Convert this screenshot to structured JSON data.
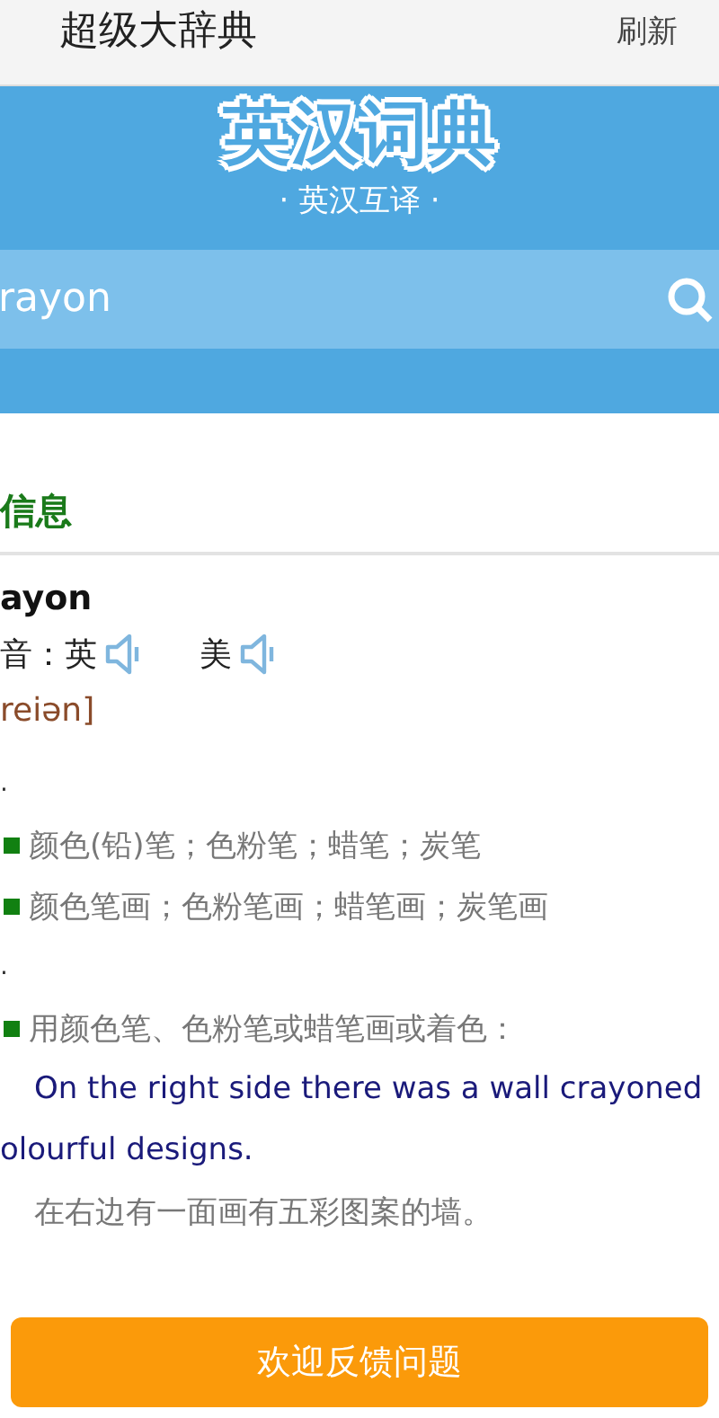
{
  "header": {
    "title": "超级大辞典",
    "action": "刷新"
  },
  "banner": {
    "logo": "英汉词典",
    "subtitle": "· 英汉互译 ·",
    "search": {
      "value": "rayon"
    }
  },
  "section": {
    "title": "信息"
  },
  "entry": {
    "word": "ayon",
    "pronunciation": {
      "label": "音：",
      "uk": "英",
      "us": "美"
    },
    "phonetic": "reiən]"
  },
  "senses": [
    {
      "kind": "pos",
      "text": "."
    },
    {
      "kind": "definition",
      "text": "颜色(铅)笔；色粉笔；蜡笔；炭笔"
    },
    {
      "kind": "definition",
      "text": "颜色笔画；色粉笔画；蜡笔画；炭笔画"
    },
    {
      "kind": "pos",
      "text": "."
    },
    {
      "kind": "definition",
      "text": "用颜色笔、色粉笔或蜡笔画或着色："
    },
    {
      "kind": "example",
      "text": "On the right side there was a wall crayoned"
    },
    {
      "kind": "example-wrap",
      "text": "olourful designs."
    },
    {
      "kind": "translation",
      "text": "在右边有一面画有五彩图案的墙。"
    }
  ],
  "feedback_button": "欢迎反馈问题"
}
